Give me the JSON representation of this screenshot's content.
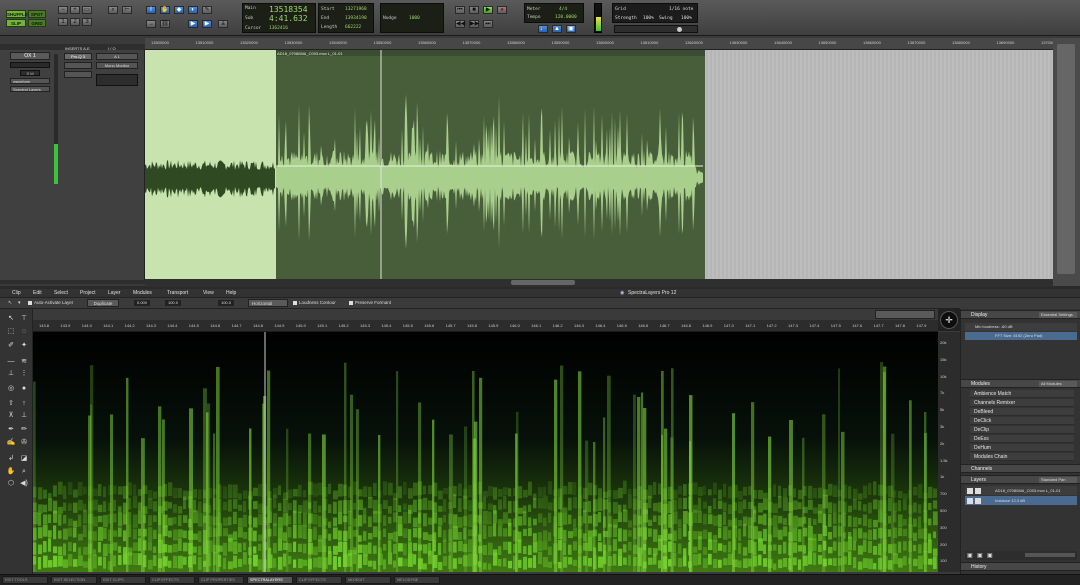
{
  "transport": {
    "main_label": "Main",
    "sub_label": "Sub",
    "main_counter": "13518354",
    "sub_counter": "4:41.632",
    "cursor_label": "Cursor",
    "cursor_value": "1362416",
    "start_label": "Start",
    "end_label": "End",
    "length_label": "Length",
    "start_value": "13271968",
    "end_value": "13934190",
    "length_value": "662222",
    "nudge_label": "Nudge",
    "nudge_value": "1000",
    "grid_label": "Grid",
    "grid_value": "1/16 note",
    "strength_label": "Strength",
    "strength_value": "100%",
    "swing_label": "Swing",
    "swing_value": "100%",
    "tempo_label": "Tempo",
    "tempo_value": "120.0000",
    "meter_label": "Meter",
    "meter_value": "4/4",
    "mode_shuffle": "SHUFFLE",
    "mode_slip": "SLIP",
    "mode_spot": "SPOT",
    "mode_grid": "GRID"
  },
  "track": {
    "name": "OX 1",
    "insert_label": "INSERTS A-E",
    "io_label": "I / O",
    "plugin": "Pro-Q 3",
    "input": "Mono Monitor",
    "view": "waveform",
    "state": "Spectral Layers",
    "clip_name": "AD18_070808AI_C003.mov L_01-01"
  },
  "ruler_ticks": [
    "13500000",
    "13510000",
    "13520000",
    "13530000",
    "13540000",
    "13550000",
    "13560000",
    "13570000",
    "13580000",
    "13590000",
    "13600000",
    "13610000",
    "13620000",
    "13630000",
    "13640000",
    "13650000",
    "13660000",
    "13670000",
    "13680000",
    "13690000",
    "13700000"
  ],
  "spectralayers": {
    "menu": [
      "Clip",
      "Edit",
      "Select",
      "Project",
      "Layer",
      "Modules",
      "Transport",
      "View",
      "Help"
    ],
    "title": "SpectraLayers Pro 12",
    "auto_activate": "Auto-Activate Layer",
    "duplicate": "Duplicate",
    "horizontal": "Horizontal",
    "loudness_contour": "Loudness Contour",
    "preserve_formant": "Preserve Formant",
    "tool_vals": [
      "0.000",
      "100.0",
      "100.0"
    ],
    "ruler_ticks": [
      "143.8",
      "143.9",
      "144.0",
      "144.1",
      "144.2",
      "144.3",
      "144.4",
      "144.5",
      "144.6",
      "144.7",
      "144.8",
      "144.9",
      "145.0",
      "145.1",
      "145.2",
      "145.3",
      "145.4",
      "145.5",
      "145.6",
      "145.7",
      "145.8",
      "145.9",
      "146.0",
      "146.1",
      "146.2",
      "146.3",
      "146.4",
      "146.5",
      "146.6",
      "146.7",
      "146.8",
      "146.9",
      "147.0",
      "147.1",
      "147.2",
      "147.3",
      "147.4",
      "147.5",
      "147.6",
      "147.7",
      "147.8",
      "147.9"
    ],
    "freq_labels": [
      "20k",
      "15k",
      "10k",
      "7k",
      "5k",
      "3k",
      "2k",
      "1.5k",
      "1k",
      "700",
      "500",
      "300",
      "200",
      "100"
    ]
  },
  "right_panel": {
    "display_title": "Display",
    "display_preset": "Essential Settings",
    "display_rows": [
      "Min loudness: -60 dB",
      "FFT Size: 8192 (Zero Pad)"
    ],
    "modules_title": "Modules",
    "modules_filter": "All Modules",
    "modules": [
      "Ambience Match",
      "Channels Remixer",
      "DeBleed",
      "DeClick",
      "DeClip",
      "DeEss",
      "DeHum",
      "Modules Chain"
    ],
    "channels_title": "Channels",
    "channels_preset": "Standard Pan",
    "layers_title": "Layers",
    "layers": [
      "AD18_070808AI_C003.mov L_01-01",
      "Instance 12.3 dB"
    ],
    "history_title": "History"
  },
  "bottom_tabs": [
    "EDIT TOOLS",
    "EDIT SELECTION",
    "EDIT CLIPS",
    "CLIP EFFECTS",
    "CLIP PROPERTIES",
    "SPECTRALAYERS",
    "CLIP EFFECTS",
    "MIX/EDIT",
    "MELODYNE"
  ],
  "colors": {
    "waveform_dark_bg": "#485e3a",
    "waveform_light_bg": "#c8e3ae",
    "spectrum_green": "#6fcf2a",
    "lcd_text": "#9dd96b",
    "accent_blue": "#4d8fd8"
  }
}
